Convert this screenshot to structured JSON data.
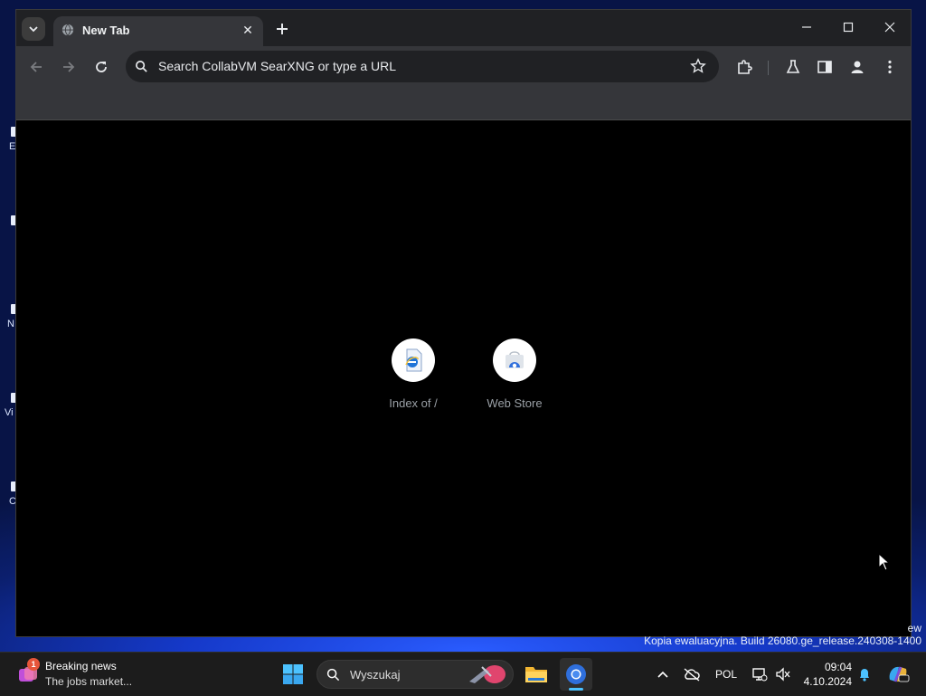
{
  "browser": {
    "tab": {
      "title": "New Tab"
    },
    "omnibox": {
      "placeholder": "Search CollabVM SearXNG or type a URL"
    },
    "shortcuts": [
      {
        "label": "Index of /",
        "icon": "ie-document-icon"
      },
      {
        "label": "Web Store",
        "icon": "web-store-icon"
      }
    ]
  },
  "desktop": {
    "watermark_fragment": "ew",
    "watermark": "Kopia ewaluacyjna. Build 26080.ge_release.240308-1400",
    "icon_fragments": [
      "E",
      "N",
      "Vi",
      "C"
    ]
  },
  "taskbar": {
    "news": {
      "badge": "1",
      "title": "Breaking news",
      "subtitle": "The jobs market..."
    },
    "search": {
      "placeholder": "Wyszukaj"
    },
    "language": "POL",
    "time": "09:04",
    "date": "4.10.2024"
  },
  "colors": {
    "accent": "#4cc2ff",
    "badge": "#e6553a"
  }
}
